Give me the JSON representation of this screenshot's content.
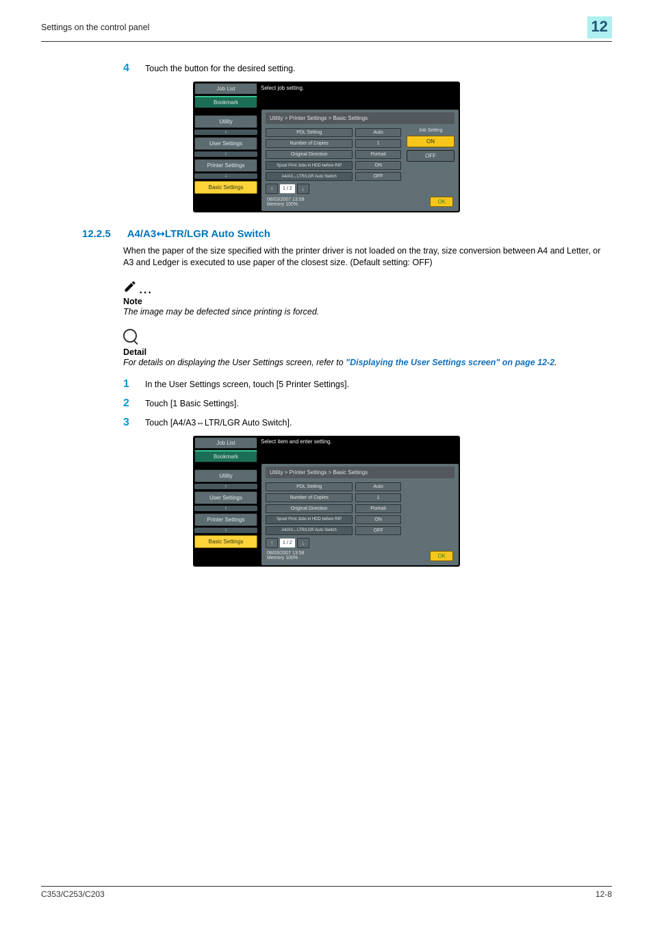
{
  "header": {
    "left": "Settings on the control panel",
    "chapter": "12"
  },
  "step4": {
    "num": "4",
    "text": "Touch the button for the desired setting."
  },
  "screenshot1": {
    "job_list": "Job List",
    "bookmark": "Bookmark",
    "title": "Select job setting.",
    "breadcrumb": "Utility > Printer Settings > Basic Settings",
    "left_tabs": {
      "utility": "Utility",
      "user_settings": "User Settings",
      "printer_settings": "Printer Settings",
      "basic_settings": "Basic Settings"
    },
    "rows": [
      {
        "label": "PDL Setting",
        "value": "Auto"
      },
      {
        "label": "Number of Copies",
        "value": "1"
      },
      {
        "label": "Original Direction",
        "value": "Portrait"
      },
      {
        "label": "Spool Print Jobs\nin HDD before RIP",
        "value": "ON"
      },
      {
        "label": "A4/A3↔LTR/LGR\nAuto Switch",
        "value": "OFF"
      }
    ],
    "page_indicator": "1 / 2",
    "side": {
      "title": "Job Setting",
      "on": "ON",
      "off": "OFF"
    },
    "footer": {
      "datetime": "08/03/2007   13:59",
      "memory": "Memory        100%",
      "ok": "OK"
    }
  },
  "section": {
    "num": "12.2.5",
    "title_a": "A4/A3",
    "title_b": "LTR/LGR Auto Switch"
  },
  "section_body": "When the paper of the size specified with the printer driver is not loaded on the tray, size conversion between A4 and Letter, or A3 and Ledger is executed to use paper of the closest size. (Default setting: OFF)",
  "note": {
    "label": "Note",
    "text": "The image may be defected since printing is forced."
  },
  "detail": {
    "label": "Detail",
    "text_a": "For details on displaying the User Settings screen, refer to ",
    "link": "\"Displaying the User Settings screen\" on page 12-2",
    "text_b": "."
  },
  "steps": [
    {
      "num": "1",
      "text": "In the User Settings screen, touch [5 Printer Settings]."
    },
    {
      "num": "2",
      "text": "Touch [1 Basic Settings]."
    },
    {
      "num": "3",
      "text": "Touch [A4/A3⇔LTR/LGR Auto Switch]."
    }
  ],
  "screenshot2": {
    "title": "Select item and enter setting.",
    "footer": {
      "datetime": "08/03/2007   13:58",
      "memory": "Memory        100%",
      "ok": "OK"
    }
  },
  "footer": {
    "left": "C353/C253/C203",
    "right": "12-8"
  }
}
